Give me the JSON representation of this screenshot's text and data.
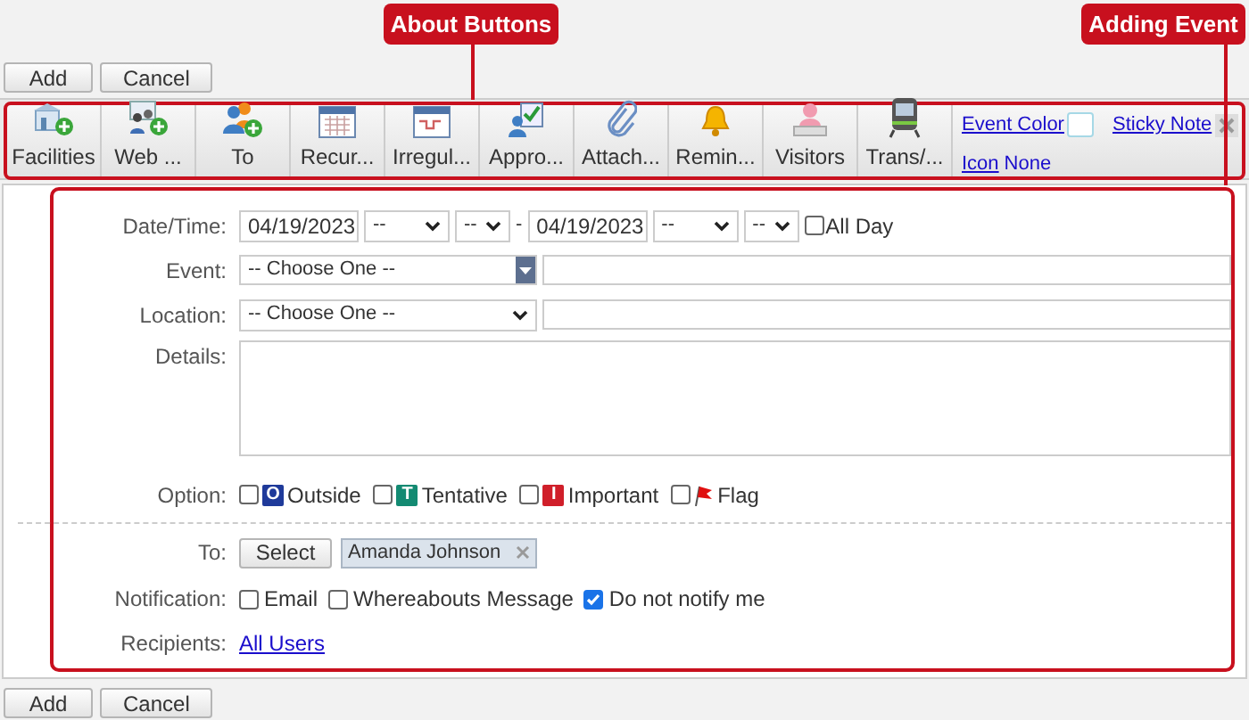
{
  "annotations": [
    {
      "label": "About Buttons"
    },
    {
      "label": "Adding Event"
    }
  ],
  "top_buttons": [
    "Add",
    "Cancel"
  ],
  "toolbar": {
    "buttons": [
      {
        "label": "Facilities"
      },
      {
        "label": "Web ..."
      },
      {
        "label": "To"
      },
      {
        "label": "Recur..."
      },
      {
        "label": "Irregul..."
      },
      {
        "label": "Appro..."
      },
      {
        "label": "Attach..."
      },
      {
        "label": "Remin..."
      },
      {
        "label": "Visitors"
      },
      {
        "label": "Trans/..."
      }
    ],
    "event_color_link": "Event Color",
    "sticky_note_link": "Sticky Note",
    "icon_link": "Icon",
    "icon_value": "None"
  },
  "form": {
    "date_time": {
      "label": "Date/Time:",
      "start_date": "04/19/2023",
      "start_hour": "--",
      "start_minute": "--",
      "separator": "-",
      "end_date": "04/19/2023",
      "end_hour": "--",
      "end_minute": "--",
      "all_day": {
        "label": "All Day",
        "checked": false
      }
    },
    "event": {
      "label": "Event:",
      "value": "-- Choose One --"
    },
    "location": {
      "label": "Location:",
      "value": "-- Choose One --"
    },
    "details": {
      "label": "Details:"
    },
    "option": {
      "label": "Option:",
      "items": [
        {
          "kind": "badge",
          "badge": "O",
          "color": "#1f3a9a",
          "label": "Outside",
          "checked": false
        },
        {
          "kind": "badge",
          "badge": "T",
          "color": "#138a72",
          "label": "Tentative",
          "checked": false
        },
        {
          "kind": "badge",
          "badge": "I",
          "color": "#d01f2a",
          "label": "Important",
          "checked": false
        },
        {
          "kind": "flag",
          "label": "Flag",
          "checked": false
        }
      ]
    },
    "to": {
      "label": "To:",
      "button": "Select",
      "attendees": [
        "Amanda Johnson"
      ]
    },
    "notification": {
      "label": "Notification:",
      "items": [
        {
          "label": "Email",
          "checked": false
        },
        {
          "label": "Whereabouts Message",
          "checked": false
        },
        {
          "label": "Do not notify me",
          "checked": true
        }
      ]
    },
    "recipients": {
      "label": "Recipients:",
      "link": "All Users"
    }
  },
  "bottom_buttons": [
    "Add",
    "Cancel"
  ]
}
